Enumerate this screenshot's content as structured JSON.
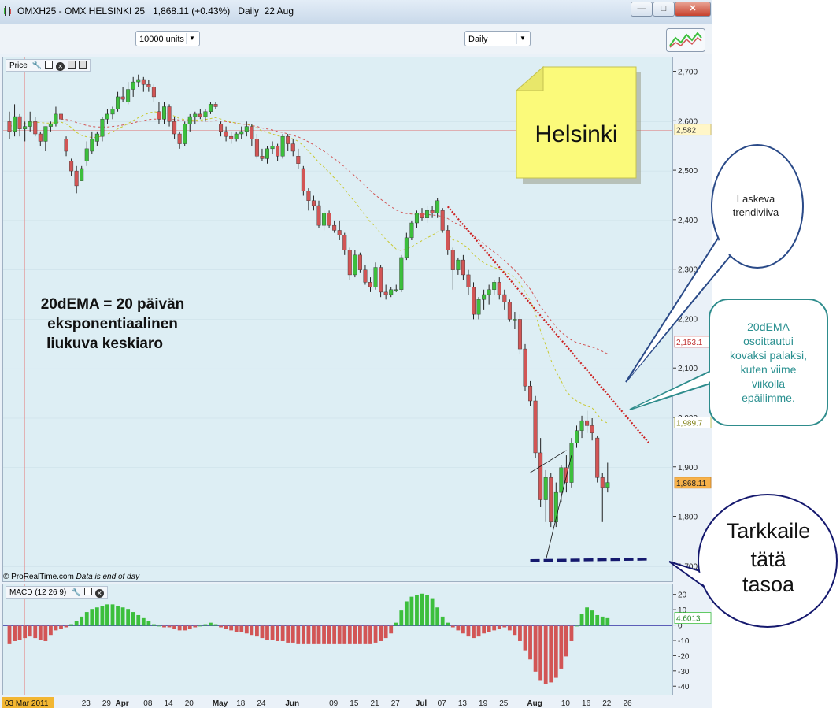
{
  "window": {
    "title": "OMXH25 - OMX HELSINKI 25",
    "last_price": "1,868.11",
    "change": "(+0.43%)",
    "period": "Daily",
    "date": "22 Aug",
    "buttons": {
      "minimize": "—",
      "maximize": "□",
      "close": "✕"
    }
  },
  "toolbar": {
    "units_select": "10000 units",
    "period_select": "Daily",
    "chart_style_icon": "chart-style-icon"
  },
  "price_panel": {
    "label": "Price"
  },
  "macd_panel": {
    "label": "MACD (12 26 9)"
  },
  "credit": {
    "source": "© ProRealTime.com",
    "note": "Data is end of day"
  },
  "annotations": {
    "sticky_note": "Helsinki",
    "ema_explanation_line1": "20dEMA = 20 päivän",
    "ema_explanation_line2": "eksponentiaalinen",
    "ema_explanation_line3": "liukuva keskiaro",
    "bubble_trendline_line1": "Laskeva",
    "bubble_trendline_line2": "trendiviiva",
    "bubble_ema_line1": "20dEMA",
    "bubble_ema_line2": "osoittautui",
    "bubble_ema_line3": "kovaksi palaksi,",
    "bubble_ema_line4": "kuten viime",
    "bubble_ema_line5": "viikolla",
    "bubble_ema_line6": "epäilimme.",
    "bubble_level_line1": "Tarkkaile",
    "bubble_level_line2": "tätä",
    "bubble_level_line3": "tasoa"
  },
  "colors": {
    "up_candle": "#3cbf3c",
    "down_candle": "#d25555",
    "ema20": "#c8c832",
    "ema_slow": "#d25555",
    "trendline": "#cc2222",
    "support_line": "#15196e",
    "macd_up": "#3cbf3c",
    "macd_down": "#d25555",
    "price_bg": "#ddeef4"
  },
  "chart_data": [
    {
      "type": "candlestick",
      "title": "OMXH25 - OMX HELSINKI 25",
      "ylim": [
        1675,
        2720
      ],
      "y_ticks": [
        "2,700",
        "2,600",
        "2,500",
        "2,400",
        "2,300",
        "2,200",
        "2,100",
        "2,000",
        "1,900",
        "1,800",
        "1,700"
      ],
      "y_tick_values": [
        2700,
        2600,
        2500,
        2400,
        2300,
        2200,
        2100,
        2000,
        1900,
        1800,
        1700
      ],
      "x_labels": [
        "03 Mar 2011",
        "23",
        "29",
        "Apr",
        "08",
        "14",
        "20",
        "May",
        "18",
        "24",
        "Jun",
        "09",
        "15",
        "21",
        "27",
        "Jul",
        "07",
        "13",
        "19",
        "25",
        "Aug",
        "10",
        "16",
        "22",
        "26"
      ],
      "x_label_index": [
        0,
        15,
        19,
        22,
        27,
        31,
        35,
        41,
        45,
        49,
        55,
        63,
        67,
        71,
        75,
        80,
        84,
        88,
        92,
        96,
        102,
        108,
        112,
        116,
        120
      ],
      "value_tags": [
        {
          "value": 2582,
          "label": "2,582"
        },
        {
          "value": 2153.1,
          "label": "2,153.1"
        },
        {
          "value": 1989.7,
          "label": "1,989.7"
        },
        {
          "value": 1868.11,
          "label": "1,868.11"
        }
      ],
      "reference_line": 2582,
      "ohlc": [
        [
          2600,
          2620,
          2565,
          2580
        ],
        [
          2580,
          2635,
          2570,
          2610
        ],
        [
          2610,
          2615,
          2570,
          2585
        ],
        [
          2585,
          2600,
          2560,
          2590
        ],
        [
          2590,
          2620,
          2580,
          2600
        ],
        [
          2600,
          2610,
          2570,
          2575
        ],
        [
          2575,
          2580,
          2550,
          2560
        ],
        [
          2560,
          2590,
          2540,
          2590
        ],
        [
          2590,
          2600,
          2580,
          2595
        ],
        [
          2595,
          2630,
          2590,
          2615
        ],
        [
          2615,
          2620,
          2600,
          2605
        ],
        [
          2565,
          2570,
          2530,
          2540
        ],
        [
          2520,
          2525,
          2490,
          2500
        ],
        [
          2500,
          2510,
          2455,
          2470
        ],
        [
          2480,
          2510,
          2480,
          2505
        ],
        [
          2520,
          2560,
          2510,
          2545
        ],
        [
          2540,
          2580,
          2535,
          2565
        ],
        [
          2560,
          2580,
          2550,
          2575
        ],
        [
          2570,
          2610,
          2560,
          2605
        ],
        [
          2605,
          2625,
          2595,
          2615
        ],
        [
          2615,
          2630,
          2605,
          2625
        ],
        [
          2625,
          2660,
          2620,
          2650
        ],
        [
          2650,
          2670,
          2640,
          2645
        ],
        [
          2640,
          2680,
          2635,
          2665
        ],
        [
          2665,
          2690,
          2650,
          2680
        ],
        [
          2680,
          2695,
          2670,
          2685
        ],
        [
          2685,
          2690,
          2660,
          2675
        ],
        [
          2675,
          2685,
          2660,
          2670
        ],
        [
          2670,
          2675,
          2640,
          2650
        ],
        [
          2620,
          2640,
          2595,
          2605
        ],
        [
          2605,
          2640,
          2595,
          2630
        ],
        [
          2630,
          2635,
          2590,
          2600
        ],
        [
          2600,
          2610,
          2565,
          2575
        ],
        [
          2575,
          2580,
          2545,
          2555
        ],
        [
          2555,
          2600,
          2550,
          2595
        ],
        [
          2595,
          2615,
          2580,
          2610
        ],
        [
          2610,
          2620,
          2595,
          2615
        ],
        [
          2615,
          2625,
          2605,
          2610
        ],
        [
          2610,
          2625,
          2600,
          2620
        ],
        [
          2620,
          2640,
          2615,
          2635
        ],
        [
          2635,
          2640,
          2625,
          2630
        ],
        [
          2595,
          2600,
          2570,
          2580
        ],
        [
          2580,
          2590,
          2560,
          2570
        ],
        [
          2570,
          2580,
          2555,
          2565
        ],
        [
          2565,
          2580,
          2560,
          2575
        ],
        [
          2575,
          2590,
          2565,
          2580
        ],
        [
          2580,
          2600,
          2570,
          2590
        ],
        [
          2590,
          2595,
          2550,
          2565
        ],
        [
          2565,
          2575,
          2525,
          2530
        ],
        [
          2530,
          2545,
          2520,
          2525
        ],
        [
          2525,
          2550,
          2515,
          2545
        ],
        [
          2545,
          2560,
          2535,
          2550
        ],
        [
          2550,
          2555,
          2520,
          2530
        ],
        [
          2530,
          2575,
          2525,
          2570
        ],
        [
          2570,
          2575,
          2540,
          2555
        ],
        [
          2555,
          2565,
          2530,
          2540
        ],
        [
          2530,
          2545,
          2505,
          2515
        ],
        [
          2505,
          2510,
          2450,
          2460
        ],
        [
          2460,
          2465,
          2420,
          2440
        ],
        [
          2440,
          2450,
          2420,
          2430
        ],
        [
          2430,
          2440,
          2385,
          2390
        ],
        [
          2390,
          2420,
          2380,
          2415
        ],
        [
          2415,
          2420,
          2385,
          2390
        ],
        [
          2390,
          2400,
          2375,
          2380
        ],
        [
          2380,
          2400,
          2360,
          2370
        ],
        [
          2370,
          2375,
          2330,
          2340
        ],
        [
          2340,
          2345,
          2280,
          2290
        ],
        [
          2290,
          2340,
          2285,
          2330
        ],
        [
          2330,
          2335,
          2295,
          2300
        ],
        [
          2300,
          2310,
          2270,
          2275
        ],
        [
          2275,
          2285,
          2255,
          2265
        ],
        [
          2265,
          2315,
          2260,
          2305
        ],
        [
          2305,
          2310,
          2245,
          2255
        ],
        [
          2255,
          2270,
          2240,
          2250
        ],
        [
          2250,
          2265,
          2245,
          2260
        ],
        [
          2260,
          2270,
          2255,
          2260
        ],
        [
          2260,
          2330,
          2255,
          2325
        ],
        [
          2325,
          2375,
          2320,
          2365
        ],
        [
          2365,
          2400,
          2360,
          2395
        ],
        [
          2395,
          2420,
          2385,
          2415
        ],
        [
          2415,
          2425,
          2400,
          2405
        ],
        [
          2405,
          2430,
          2395,
          2420
        ],
        [
          2420,
          2430,
          2405,
          2415
        ],
        [
          2415,
          2445,
          2405,
          2440
        ],
        [
          2420,
          2425,
          2375,
          2380
        ],
        [
          2380,
          2390,
          2330,
          2340
        ],
        [
          2340,
          2345,
          2260,
          2300
        ],
        [
          2300,
          2325,
          2290,
          2320
        ],
        [
          2320,
          2330,
          2280,
          2290
        ],
        [
          2290,
          2300,
          2250,
          2265
        ],
        [
          2265,
          2275,
          2200,
          2210
        ],
        [
          2210,
          2245,
          2200,
          2240
        ],
        [
          2240,
          2260,
          2220,
          2250
        ],
        [
          2250,
          2270,
          2230,
          2260
        ],
        [
          2260,
          2280,
          2250,
          2275
        ],
        [
          2275,
          2285,
          2240,
          2250
        ],
        [
          2250,
          2260,
          2220,
          2235
        ],
        [
          2235,
          2240,
          2195,
          2200
        ],
        [
          2200,
          2215,
          2180,
          2200
        ],
        [
          2200,
          2210,
          2130,
          2140
        ],
        [
          2140,
          2150,
          2055,
          2065
        ],
        [
          2065,
          2075,
          2025,
          2035
        ],
        [
          2035,
          2045,
          1920,
          1930
        ],
        [
          1930,
          1960,
          1820,
          1835
        ],
        [
          1835,
          1895,
          1790,
          1880
        ],
        [
          1880,
          1890,
          1780,
          1790
        ],
        [
          1790,
          1870,
          1780,
          1850
        ],
        [
          1850,
          1905,
          1830,
          1900
        ],
        [
          1900,
          1925,
          1850,
          1870
        ],
        [
          1870,
          1960,
          1860,
          1950
        ],
        [
          1950,
          1985,
          1940,
          1975
        ],
        [
          1975,
          2005,
          1960,
          1995
        ],
        [
          1995,
          2015,
          1970,
          1985
        ],
        [
          1985,
          2000,
          1955,
          1970
        ],
        [
          1960,
          1965,
          1870,
          1880
        ],
        [
          1880,
          1890,
          1790,
          1860
        ],
        [
          1860,
          1910,
          1850,
          1870
        ]
      ],
      "ema20": [
        2590,
        2593,
        2594,
        2596,
        2598,
        2599,
        2598,
        2597,
        2597,
        2598,
        2599,
        2595,
        2588,
        2578,
        2572,
        2569,
        2568,
        2568,
        2571,
        2575,
        2579,
        2585,
        2590,
        2596,
        2602,
        2608,
        2613,
        2617,
        2620,
        2618,
        2617,
        2615,
        2611,
        2606,
        2604,
        2603,
        2603,
        2603,
        2604,
        2606,
        2608,
        2605,
        2602,
        2599,
        2597,
        2595,
        2595,
        2592,
        2587,
        2581,
        2578,
        2575,
        2571,
        2570,
        2567,
        2565,
        2560,
        2551,
        2540,
        2530,
        2517,
        2508,
        2497,
        2486,
        2475,
        2463,
        2449,
        2438,
        2424,
        2410,
        2397,
        2387,
        2374,
        2362,
        2352,
        2342,
        2339,
        2342,
        2347,
        2353,
        2359,
        2365,
        2370,
        2377,
        2377,
        2373,
        2361,
        2358,
        2351,
        2344,
        2331,
        2322,
        2314,
        2309,
        2305,
        2301,
        2297,
        2291,
        2284,
        2273,
        2256,
        2238,
        2212,
        2177,
        2148,
        2118,
        2094,
        2075,
        2055,
        2043,
        2035,
        2029,
        2025,
        2021,
        2008,
        1995,
        1990
      ],
      "ema_slow": [
        null,
        null,
        null,
        null,
        null,
        null,
        null,
        null,
        null,
        null,
        2605,
        2604,
        2602,
        2598,
        2595,
        2592,
        2590,
        2589,
        2589,
        2589,
        2590,
        2591,
        2593,
        2595,
        2597,
        2600,
        2602,
        2604,
        2605,
        2605,
        2605,
        2605,
        2604,
        2603,
        2602,
        2601,
        2601,
        2601,
        2601,
        2601,
        2602,
        2601,
        2600,
        2598,
        2597,
        2595,
        2594,
        2592,
        2590,
        2587,
        2585,
        2583,
        2580,
        2578,
        2575,
        2572,
        2569,
        2564,
        2559,
        2553,
        2546,
        2540,
        2533,
        2525,
        2517,
        2508,
        2499,
        2490,
        2480,
        2470,
        2460,
        2451,
        2443,
        2435,
        2428,
        2421,
        2417,
        2414,
        2413,
        2412,
        2413,
        2412,
        2411,
        2410,
        2408,
        2404,
        2397,
        2392,
        2386,
        2378,
        2369,
        2361,
        2352,
        2344,
        2336,
        2328,
        2319,
        2309,
        2299,
        2288,
        2274,
        2261,
        2244,
        2226,
        2212,
        2198,
        2185,
        2174,
        2165,
        2158,
        2153,
        2150,
        2147,
        2144,
        2140,
        2135,
        2130
      ],
      "trendline": [
        [
          85,
          2428
        ],
        [
          124,
          1950
        ]
      ],
      "support": [
        [
          101,
          1712
        ],
        [
          124,
          1715
        ]
      ],
      "wedge_upper": [
        [
          101,
          1890
        ],
        [
          108,
          1935
        ]
      ],
      "wedge_lower": [
        [
          104,
          1712
        ],
        [
          109,
          1925
        ]
      ]
    },
    {
      "type": "bar",
      "title": "MACD (12 26 9)",
      "ylim": [
        -44,
        25
      ],
      "y_ticks": [
        "20",
        "10",
        "0",
        "-10",
        "-20",
        "-30",
        "-40"
      ],
      "y_tick_values": [
        20,
        10,
        0,
        -10,
        -20,
        -30,
        -40
      ],
      "value_tag": {
        "value": 4.6013,
        "label": "4.6013"
      },
      "values": [
        -12,
        -10,
        -9,
        -8,
        -7,
        -8,
        -9,
        -10,
        -6,
        -3,
        -2,
        -1,
        1,
        3,
        6,
        9,
        11,
        12,
        13,
        14,
        14,
        13,
        12,
        11,
        9,
        7,
        5,
        3,
        1,
        0,
        -1,
        -1,
        -2,
        -3,
        -3,
        -2,
        -1,
        0,
        1,
        2,
        1,
        -1,
        -2,
        -3,
        -4,
        -4,
        -5,
        -6,
        -7,
        -8,
        -9,
        -9,
        -10,
        -10,
        -11,
        -11,
        -12,
        -12,
        -12,
        -12,
        -12,
        -12,
        -12,
        -12,
        -12,
        -12,
        -12,
        -12,
        -12,
        -12,
        -12,
        -11,
        -10,
        -8,
        -5,
        2,
        10,
        16,
        19,
        20,
        21,
        20,
        18,
        12,
        6,
        2,
        -1,
        -3,
        -5,
        -7,
        -8,
        -7,
        -5,
        -4,
        -3,
        -2,
        -1,
        -3,
        -6,
        -10,
        -16,
        -22,
        -30,
        -36,
        -38,
        -37,
        -34,
        -28,
        -20,
        -10,
        0,
        8,
        12,
        10,
        7,
        6,
        5
      ]
    }
  ]
}
